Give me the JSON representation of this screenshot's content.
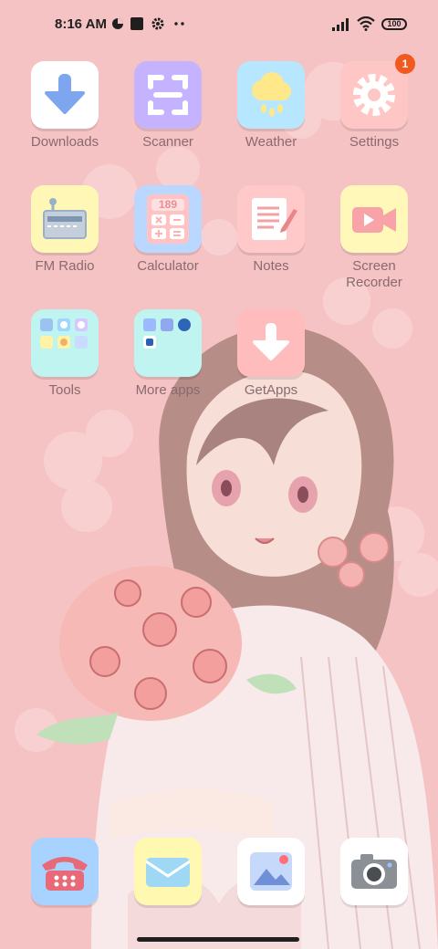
{
  "status_bar": {
    "time": "8:16 AM",
    "battery": "100",
    "icons": [
      "data-saver-icon",
      "square-notification-icon",
      "gear-notification-icon",
      "more-notifications-icon",
      "signal-icon",
      "wifi-icon",
      "battery-icon"
    ]
  },
  "apps": [
    {
      "label": "Downloads",
      "icon": "download-arrow-icon",
      "color": "#ffffff"
    },
    {
      "label": "Scanner",
      "icon": "scanner-frame-icon",
      "color": "#c6b3ff"
    },
    {
      "label": "Weather",
      "icon": "cloud-rain-icon",
      "color": "#b7e6ff"
    },
    {
      "label": "Settings",
      "icon": "gear-icon",
      "color": "#ffc6c6",
      "badge": "1"
    },
    {
      "label": "FM Radio",
      "icon": "radio-icon",
      "color": "#fff7b6"
    },
    {
      "label": "Calculator",
      "icon": "calculator-icon",
      "color": "#b9d7ff",
      "display": "189"
    },
    {
      "label": "Notes",
      "icon": "notepad-icon",
      "color": "#ffc9ca"
    },
    {
      "label": "Screen\nRecorder",
      "label_line1": "Screen",
      "label_line2": "Recorder",
      "icon": "video-camera-icon",
      "color": "#fff8b8"
    },
    {
      "label": "Tools",
      "icon": "folder-icon",
      "color": "#bff4f1"
    },
    {
      "label": "More apps",
      "icon": "folder-icon",
      "color": "#bff4f1"
    },
    {
      "label": "GetApps",
      "icon": "download-arrow-icon",
      "color": "#ffbcbc"
    }
  ],
  "dock": [
    {
      "name": "phone",
      "icon": "telephone-icon",
      "color": "#a8d2ff"
    },
    {
      "name": "messages",
      "icon": "envelope-icon",
      "color": "#fff8b0"
    },
    {
      "name": "gallery",
      "icon": "photo-icon",
      "color": "#ffffff"
    },
    {
      "name": "camera",
      "icon": "camera-icon",
      "color": "#ffffff"
    }
  ]
}
